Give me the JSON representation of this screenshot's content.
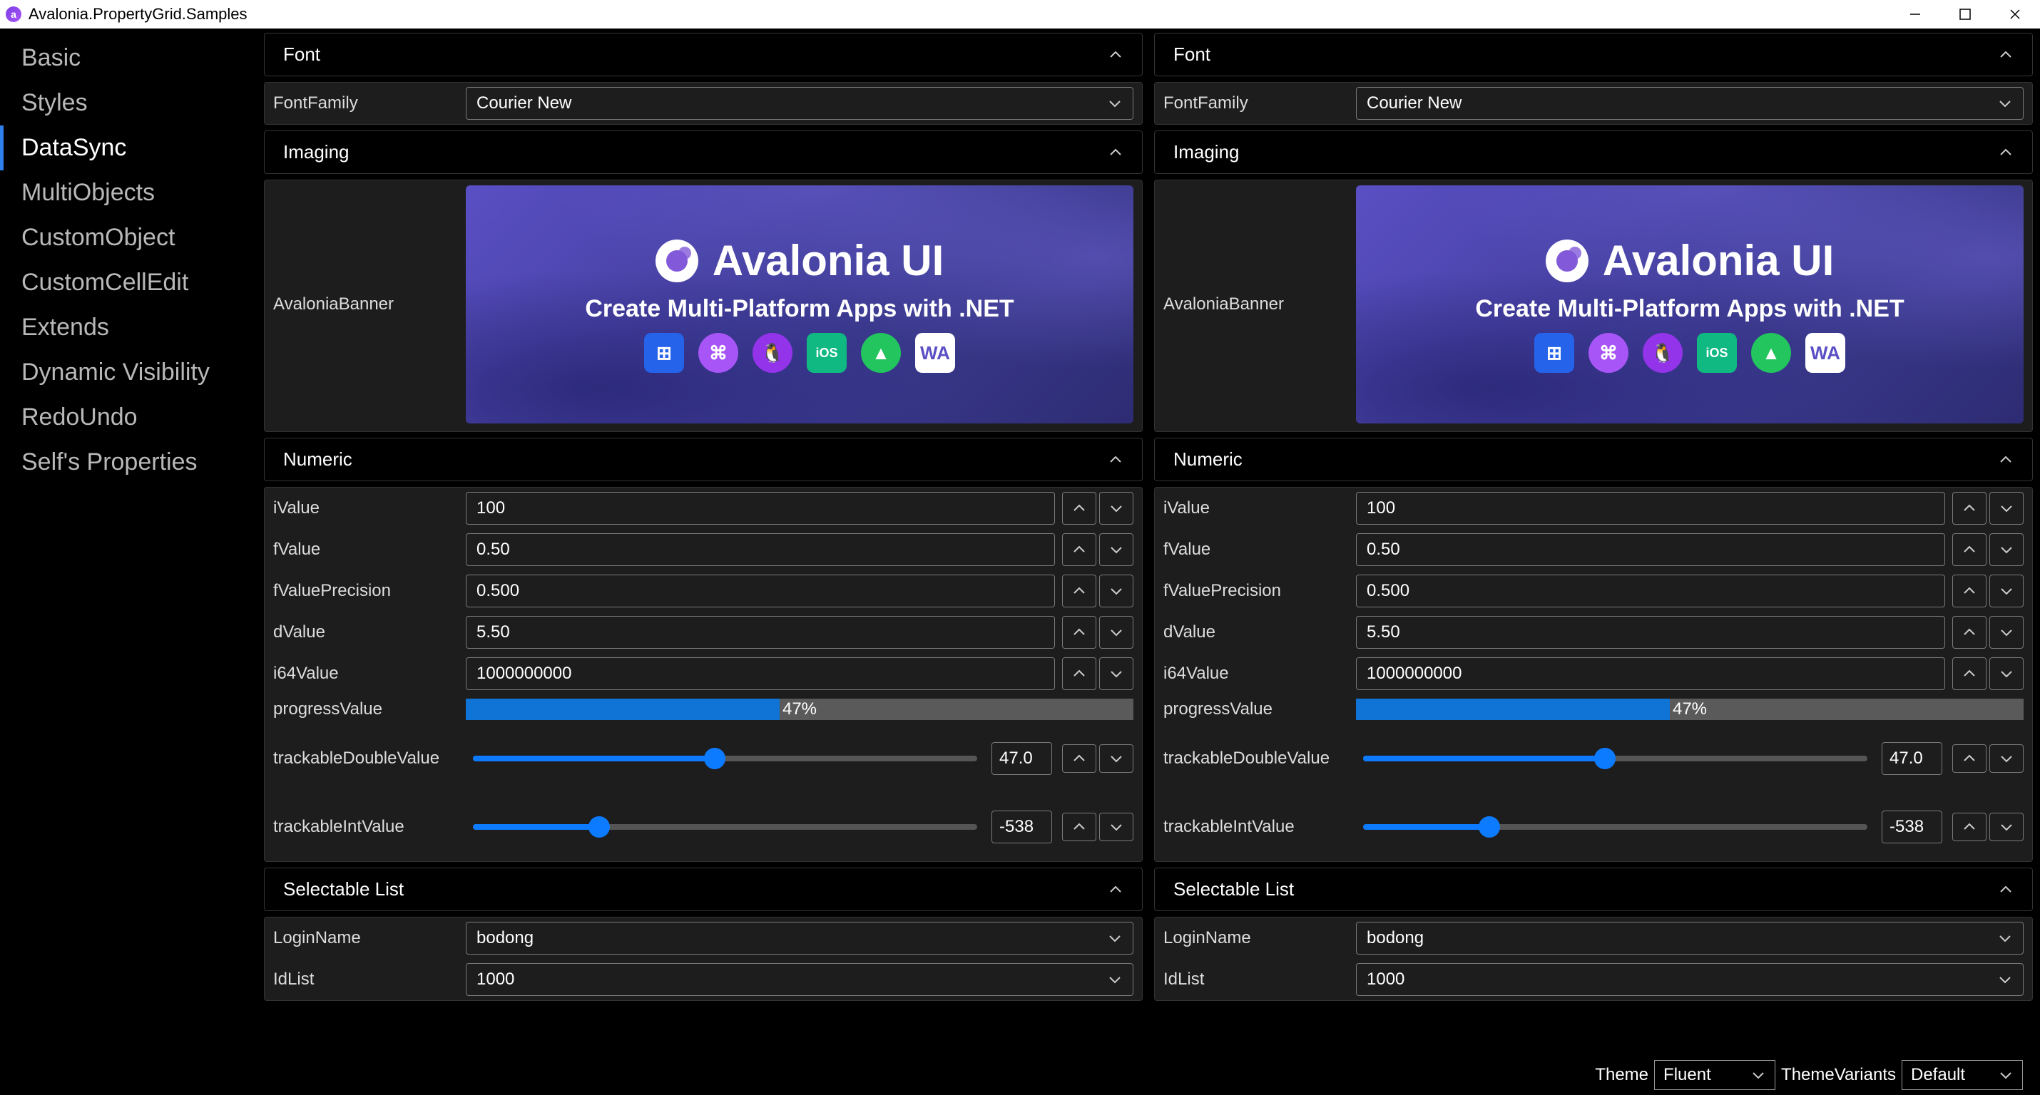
{
  "window": {
    "title": "Avalonia.PropertyGrid.Samples"
  },
  "sidebar": {
    "items": [
      {
        "label": "Basic"
      },
      {
        "label": "Styles"
      },
      {
        "label": "DataSync"
      },
      {
        "label": "MultiObjects"
      },
      {
        "label": "CustomObject"
      },
      {
        "label": "CustomCellEdit"
      },
      {
        "label": "Extends"
      },
      {
        "label": "Dynamic Visibility"
      },
      {
        "label": "RedoUndo"
      },
      {
        "label": "Self's Properties"
      }
    ],
    "active_index": 2
  },
  "categories": {
    "font": "Font",
    "imaging": "Imaging",
    "numeric": "Numeric",
    "selectable_list": "Selectable List"
  },
  "props": {
    "font_family": {
      "label": "FontFamily",
      "value": "Courier New"
    },
    "avalonia_banner": {
      "label": "AvaloniaBanner"
    },
    "iValue": {
      "label": "iValue",
      "value": "100"
    },
    "fValue": {
      "label": "fValue",
      "value": "0.50"
    },
    "fValuePrecision": {
      "label": "fValuePrecision",
      "value": "0.500"
    },
    "dValue": {
      "label": "dValue",
      "value": "5.50"
    },
    "i64Value": {
      "label": "i64Value",
      "value": "1000000000"
    },
    "progressValue": {
      "label": "progressValue",
      "text": "47%",
      "percent": 47
    },
    "trackableDouble": {
      "label": "trackableDoubleValue",
      "value": "47.0",
      "percent": 48
    },
    "trackableInt": {
      "label": "trackableIntValue",
      "value": "-538",
      "percent": 25
    },
    "loginName": {
      "label": "LoginName",
      "value": "bodong"
    },
    "idList": {
      "label": "IdList",
      "value": "1000"
    }
  },
  "banner": {
    "title": "Avalonia UI",
    "subtitle": "Create Multi-Platform Apps with .NET",
    "platforms": [
      {
        "id": "windows-icon",
        "color": "#2563eb",
        "glyph": "⊞",
        "shape": "sq"
      },
      {
        "id": "macos-icon",
        "color": "#a855f7",
        "glyph": "⌘",
        "shape": "round"
      },
      {
        "id": "linux-icon",
        "color": "#9333ea",
        "glyph": "🐧",
        "shape": "round"
      },
      {
        "id": "ios-icon",
        "color": "#10b981",
        "glyph": "iOS",
        "shape": "sq"
      },
      {
        "id": "android-icon",
        "color": "#22c55e",
        "glyph": "▲",
        "shape": "round"
      },
      {
        "id": "wasm-icon",
        "color": "#ffffff",
        "glyph": "WA",
        "shape": "sq"
      }
    ]
  },
  "footer": {
    "theme_label": "Theme",
    "theme_value": "Fluent",
    "variant_label": "ThemeVariants",
    "variant_value": "Default"
  }
}
